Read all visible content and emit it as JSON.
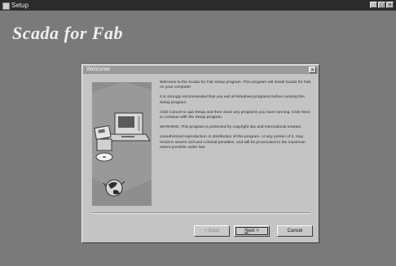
{
  "window": {
    "title": "Setup",
    "controls": {
      "minimize": "_",
      "maximize": "□",
      "close": "×"
    }
  },
  "banner": {
    "text": "Scada for Fab"
  },
  "dialog": {
    "title": "Welcome",
    "close_glyph": "×",
    "paragraphs": [
      "Welcome to the Scada for Fab Setup program. This program will install Scada for Fab on your computer.",
      "It is strongly recommended that you exit all Windows programs before running this Setup program.",
      "Click Cancel to quit Setup and then close any programs you have running. Click Next to continue with the Setup program.",
      "WARNING: This program is protected by copyright law and international treaties.",
      "Unauthorized reproduction or distribution of this program, or any portion of it, may result in severe civil and criminal penalties, and will be prosecuted to the maximum extent possible under law."
    ],
    "buttons": {
      "back": {
        "label": "< Back",
        "enabled": false
      },
      "next": {
        "accel": "N",
        "rest": "ext >"
      },
      "cancel": {
        "label": "Cancel"
      }
    },
    "illustration_icons": [
      "computer-icon",
      "disks-icon",
      "globe-icon"
    ]
  },
  "colors": {
    "desktop": "#7a7a7a",
    "dialog_face": "#c4c4c4",
    "illustration_panel": "#8e8e8e",
    "banner_text": "#efefef"
  }
}
